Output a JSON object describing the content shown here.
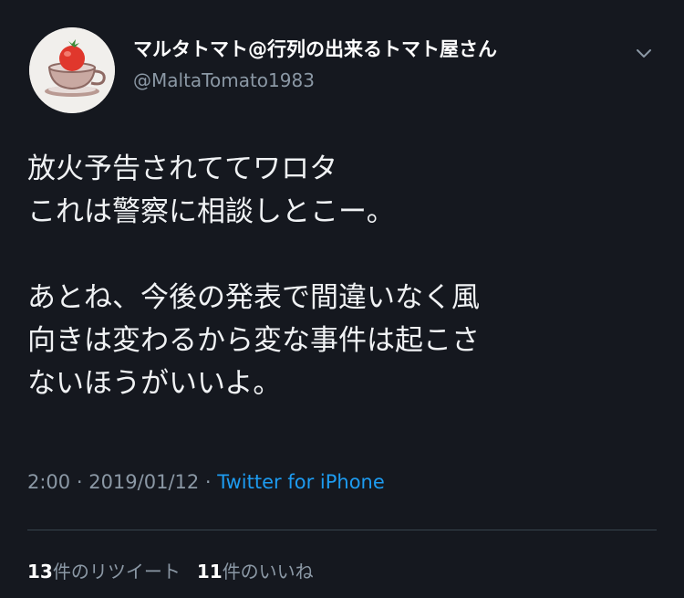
{
  "user": {
    "display_name": "マルタトマト@行列の出来るトマト屋さん",
    "handle": "@MaltaTomato1983",
    "avatar_icon": "tomato-teacup-icon"
  },
  "tweet": {
    "paragraph1": [
      "放火予告されててワロタ",
      "これは警察に相談しとこー。"
    ],
    "paragraph2": [
      "あとね、今後の発表で間違いなく風",
      "向きは変わるから変な事件は起こさ",
      "ないほうがいいよ。"
    ]
  },
  "meta": {
    "time": "2:00",
    "separator": " · ",
    "date": "2019/01/12",
    "source": "Twitter for iPhone"
  },
  "stats": {
    "retweet_count": "13",
    "retweet_label": "件のリツイート",
    "like_count": "11",
    "like_label": "件のいいね"
  },
  "colors": {
    "background": "#15181f",
    "link": "#1d9bf0",
    "muted": "#8b98a5"
  }
}
